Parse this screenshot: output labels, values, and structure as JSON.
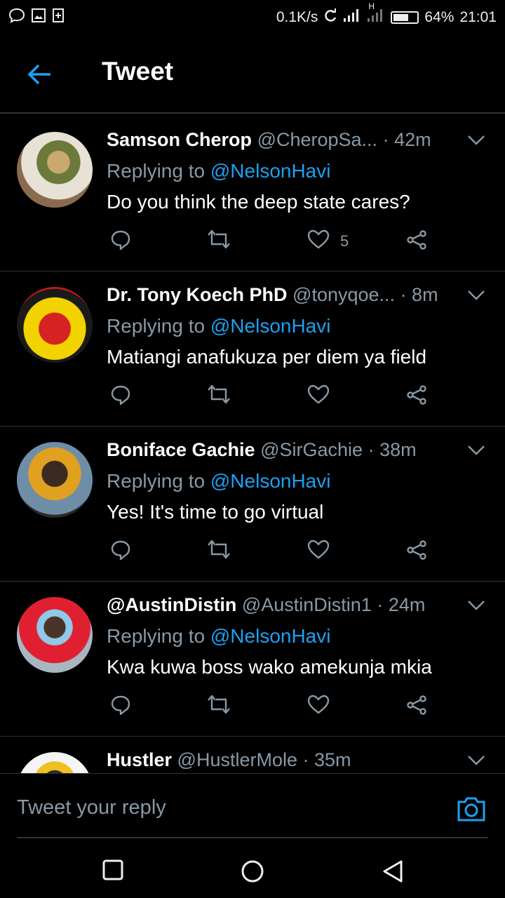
{
  "status_bar": {
    "net_speed": "0.1K/s",
    "network_type": "H",
    "battery": "64%",
    "battery_level": 0.64,
    "time": "21:01"
  },
  "header": {
    "title": "Tweet"
  },
  "tweets": [
    {
      "name": "Samson Cherop",
      "handle": "@CheropSa...",
      "time": "· 42m",
      "reply_prefix": "Replying to",
      "mention": "@NelsonHavi",
      "text": "Do you think the deep state cares?",
      "likes": "5"
    },
    {
      "name": "Dr. Tony Koech PhD",
      "handle": "@tonyqoe...",
      "time": "· 8m",
      "reply_prefix": "Replying to",
      "mention": "@NelsonHavi",
      "text": "Matiangi anafukuza per diem ya field",
      "likes": ""
    },
    {
      "name": "Boniface Gachie",
      "handle": "@SirGachie",
      "time": "· 38m",
      "reply_prefix": "Replying to",
      "mention": "@NelsonHavi",
      "text": "Yes! It's time to go virtual",
      "likes": ""
    },
    {
      "name": "@AustinDistin",
      "handle": "@AustinDistin1",
      "time": "· 24m",
      "reply_prefix": "Replying to",
      "mention": "@NelsonHavi",
      "text": "Kwa kuwa boss wako amekunja mkia",
      "likes": ""
    },
    {
      "name": "Hustler",
      "handle": "@HustlerMole",
      "time": "· 35m",
      "reply_prefix": "",
      "mention": "",
      "text": "",
      "likes": ""
    }
  ],
  "reply_bar": {
    "placeholder": "Tweet your reply"
  },
  "colors": {
    "accent": "#1da1f2",
    "muted": "#8899a6",
    "divider": "#2f3336"
  }
}
